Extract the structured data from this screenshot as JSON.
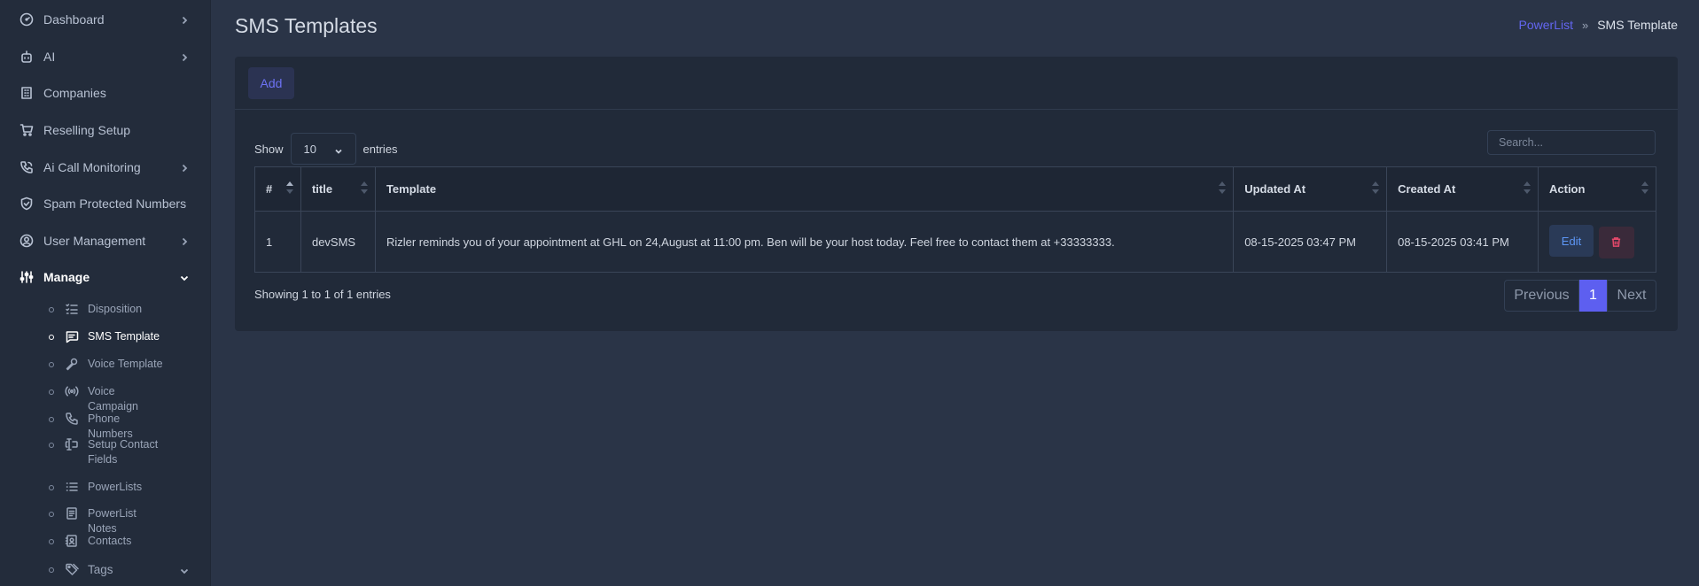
{
  "sidebar": {
    "items": [
      {
        "label": "Dashboard",
        "icon": "gauge-icon",
        "chevron": "right"
      },
      {
        "label": "AI",
        "icon": "robot-icon",
        "chevron": "right"
      },
      {
        "label": "Companies",
        "icon": "building-icon"
      },
      {
        "label": "Reselling Setup",
        "icon": "cart-icon"
      },
      {
        "label": "Ai Call Monitoring",
        "icon": "phone-call-icon",
        "chevron": "right"
      },
      {
        "label": "Spam Protected Numbers",
        "icon": "shield-check-icon"
      },
      {
        "label": "User Management",
        "icon": "user-circle-icon",
        "chevron": "right"
      },
      {
        "label": "Manage",
        "icon": "sliders-icon",
        "chevron": "down",
        "active": true
      }
    ],
    "sub_items": [
      {
        "label": "Disposition",
        "icon": "checklist-icon"
      },
      {
        "label": "SMS Template",
        "icon": "message-icon",
        "active": true
      },
      {
        "label": "Voice Template",
        "icon": "microphone-icon"
      },
      {
        "label": "Voice Campaign",
        "icon": "broadcast-icon"
      },
      {
        "label": "Phone Numbers",
        "icon": "phone-icon"
      },
      {
        "label": "Setup Contact Fields",
        "icon": "forms-icon"
      },
      {
        "label": "PowerLists",
        "icon": "list-icon"
      },
      {
        "label": "PowerList Notes",
        "icon": "notes-icon"
      },
      {
        "label": "Contacts",
        "icon": "address-book-icon"
      },
      {
        "label": "Tags",
        "icon": "tag-icon",
        "chevron": "down"
      }
    ]
  },
  "header": {
    "title": "SMS Templates",
    "breadcrumb": {
      "link": "PowerList",
      "separator": "»",
      "current": "SMS Template"
    }
  },
  "toolbar": {
    "add_label": "Add"
  },
  "table_controls": {
    "show_label": "Show",
    "page_size": "10",
    "entries_label": "entries",
    "search_placeholder": "Search..."
  },
  "table": {
    "columns": [
      "#",
      "title",
      "Template",
      "Updated At",
      "Created At",
      "Action"
    ],
    "rows": [
      {
        "num": "1",
        "title": "devSMS",
        "template": "Rizler reminds you of your appointment at GHL on 24,August at 11:00 pm. Ben will be your host today. Feel free to contact them at +33333333.",
        "updated_at": "08-15-2025 03:47 PM",
        "created_at": "08-15-2025 03:41 PM",
        "edit_label": "Edit"
      }
    ]
  },
  "footer": {
    "info": "Showing 1 to 1 of 1 entries",
    "prev_label": "Previous",
    "page": "1",
    "next_label": "Next"
  },
  "colors": {
    "accent": "#6366f1",
    "page_bg": "#2a3447",
    "sidebar_bg": "#232c3b",
    "card_bg": "#212a39",
    "danger": "#e3486a"
  }
}
